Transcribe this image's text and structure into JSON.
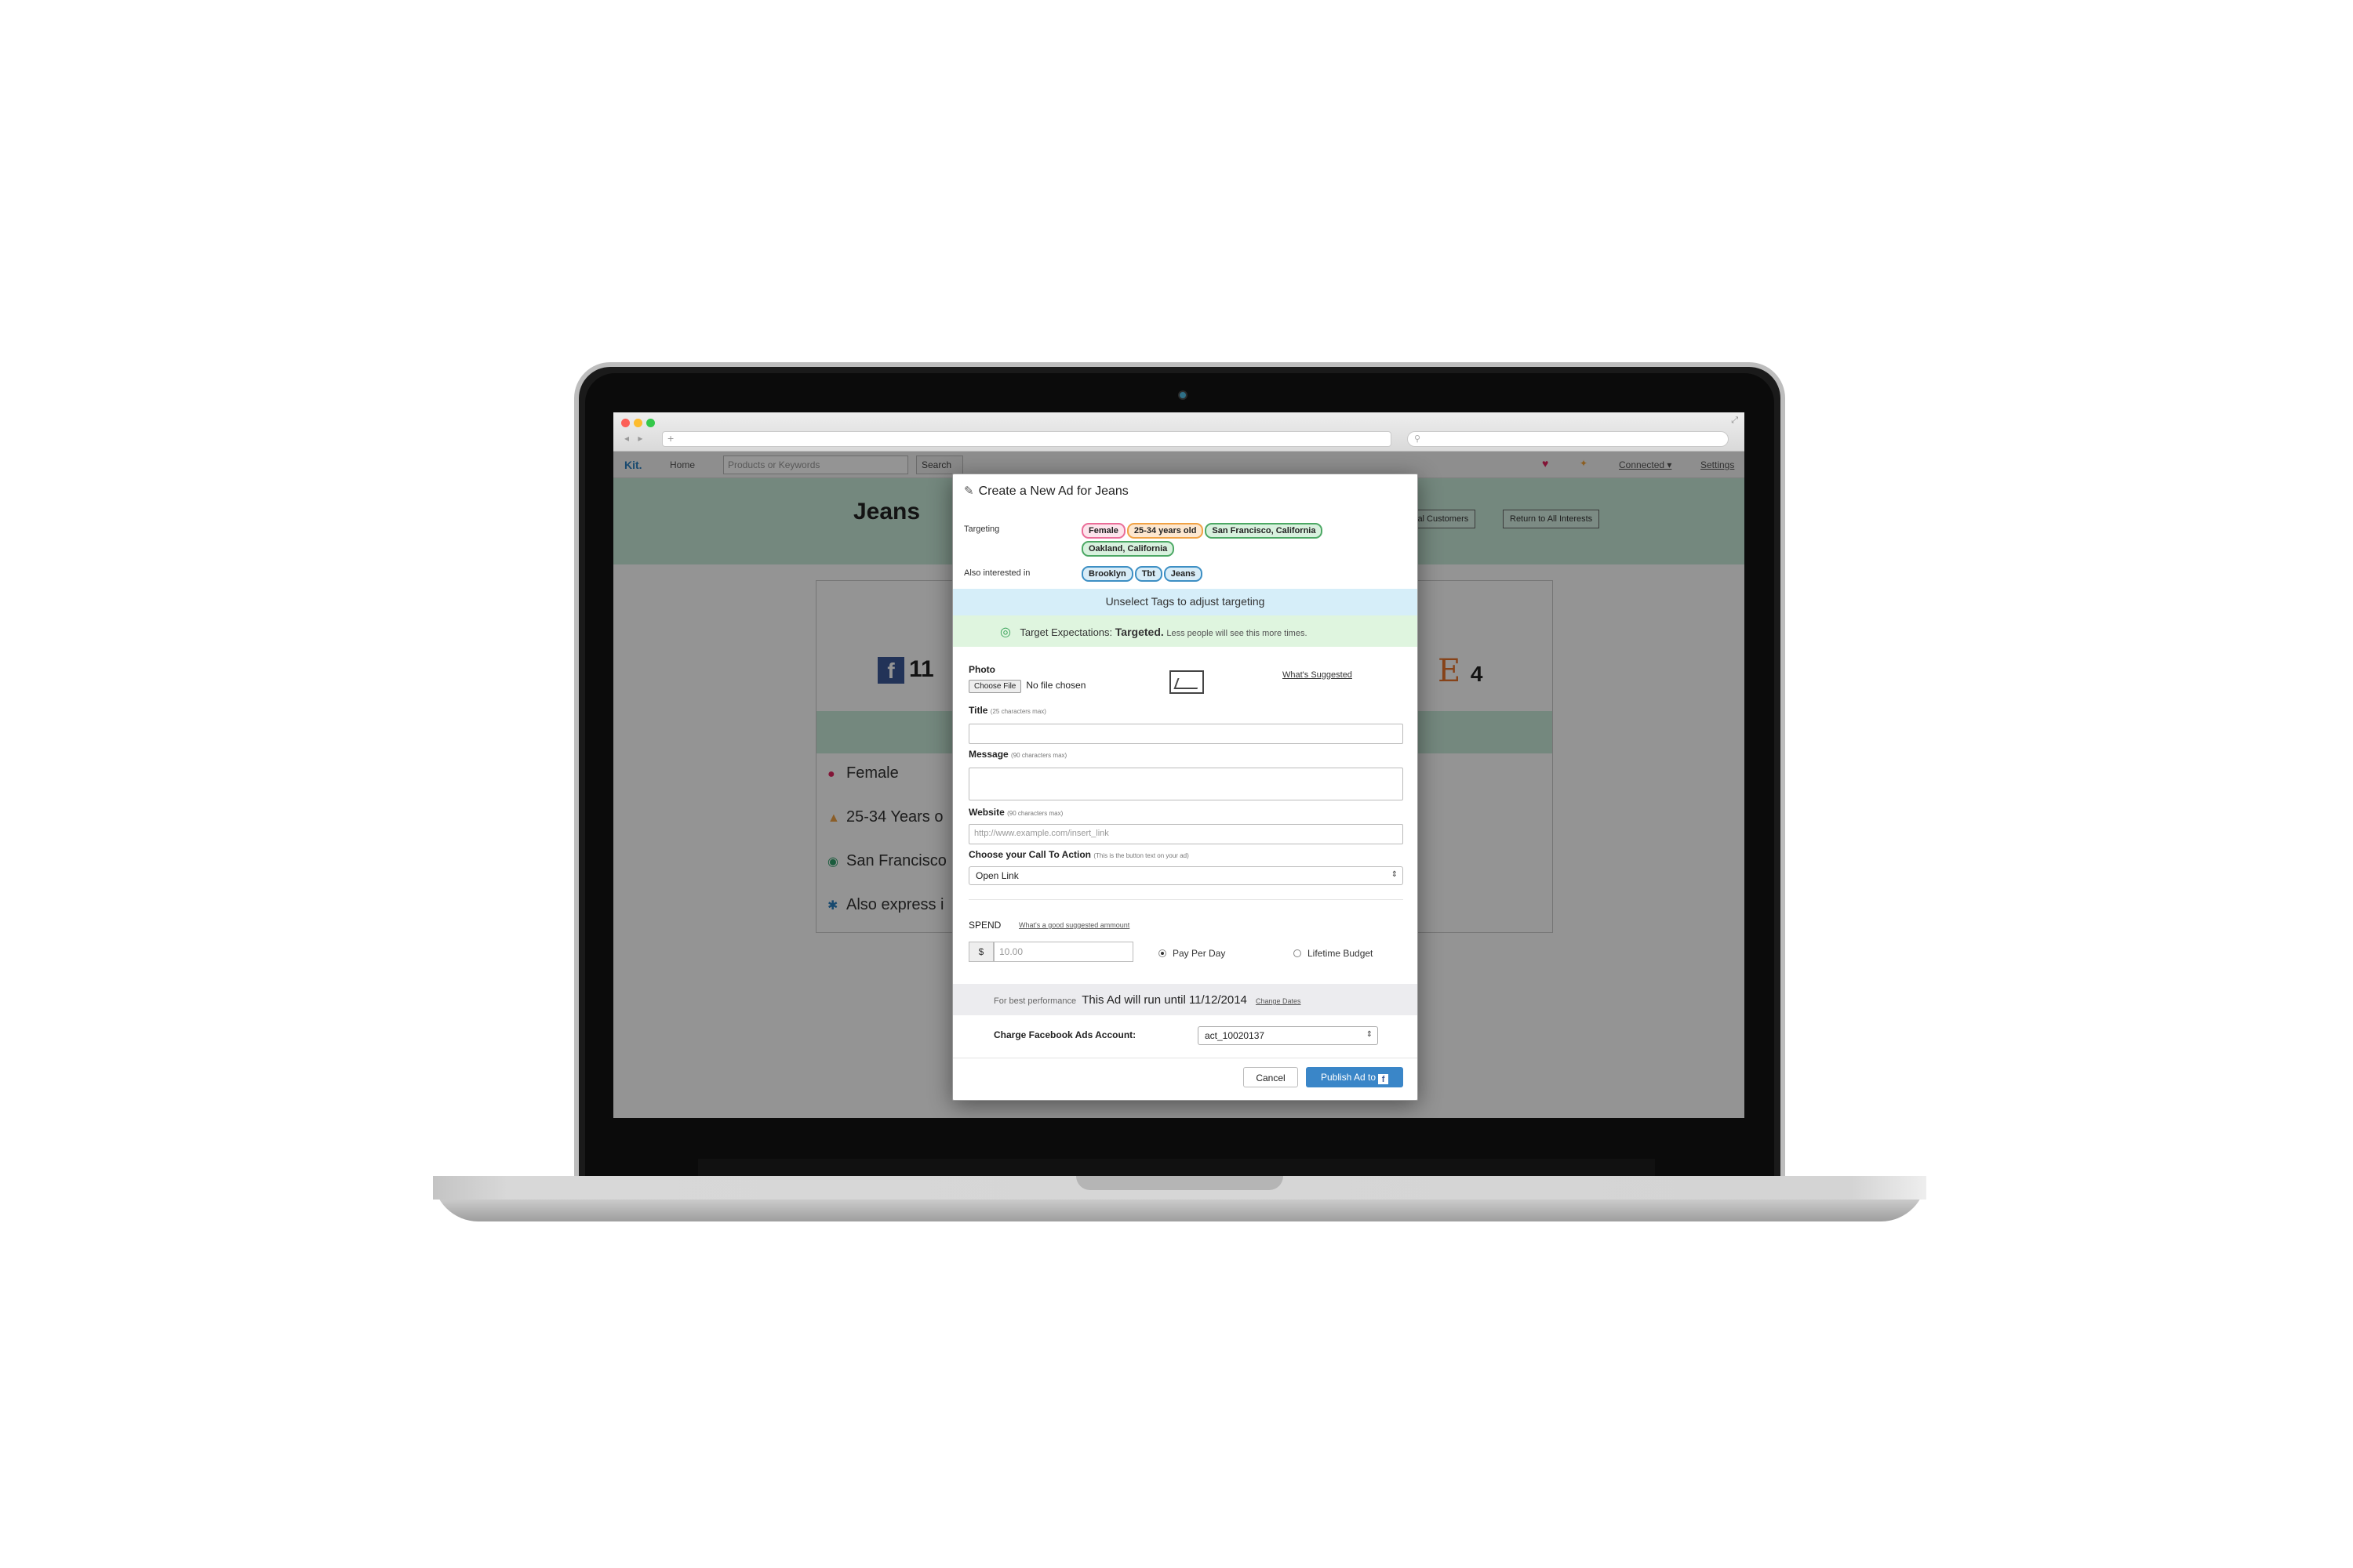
{
  "browser": {
    "url": "",
    "search": ""
  },
  "appnav": {
    "brand": "Kit.",
    "home": "Home",
    "search_placeholder": "Products or Keywords",
    "search_button": "Search",
    "connected": "Connected ▾",
    "settings": "Settings"
  },
  "hero": {
    "title": "Jeans",
    "button_customers": "ial Customers",
    "button_return": "Return to All Interests"
  },
  "card": {
    "fb_count": "11",
    "e_count": "4",
    "attributes": [
      "Female",
      "25-34 Years o",
      "San Francisco",
      "Also express i"
    ]
  },
  "modal": {
    "title": "Create a New Ad for Jeans",
    "targeting_label": "Targeting",
    "targeting_tags": [
      {
        "label": "Female",
        "color": "pink"
      },
      {
        "label": "25-34 years old",
        "color": "orange"
      },
      {
        "label": "San Francisco, California",
        "color": "green"
      },
      {
        "label": "Oakland, California",
        "color": "green"
      }
    ],
    "interests_label": "Also interested in",
    "interest_tags": [
      "Brooklyn",
      "Tbt",
      "Jeans"
    ],
    "info_bar": "Unselect Tags to adjust targeting",
    "target_prefix": "Target Expectations:",
    "target_strong": "Targeted.",
    "target_note": "Less people will see this more times.",
    "photo_label": "Photo",
    "choose_file": "Choose File",
    "no_file": "No file chosen",
    "whats_suggested": "What's Suggested",
    "title_label": "Title",
    "title_hint": "(25 characters max)",
    "message_label": "Message",
    "message_hint": "(90 characters max)",
    "website_label": "Website",
    "website_hint": "(90 characters max)",
    "website_placeholder": "http://www.example.com/insert_link",
    "cta_label": "Choose your Call To Action",
    "cta_hint": "(This is the button text on your ad)",
    "cta_value": "Open Link",
    "spend_label": "SPEND",
    "spend_link": "What's a good suggested ammount",
    "currency": "$",
    "amount_placeholder": "10.00",
    "radio_per_day": "Pay Per Day",
    "radio_lifetime": "Lifetime Budget",
    "run_prefix": "For best performance",
    "run_text": "This Ad will run until 11/12/2014",
    "change_dates": "Change Dates",
    "charge_label": "Charge Facebook Ads Account:",
    "account_value": "act_10020137",
    "cancel": "Cancel",
    "publish": "Publish Ad to"
  }
}
